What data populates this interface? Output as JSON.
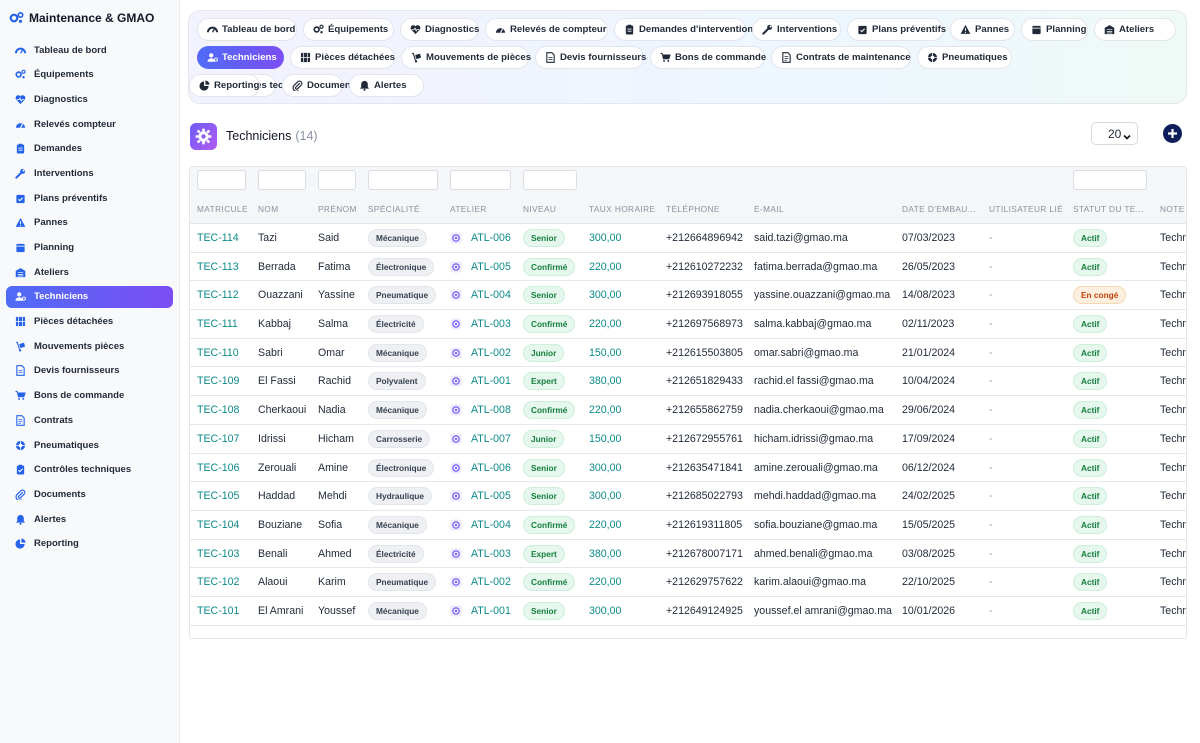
{
  "app": {
    "title": "Maintenance & GMAO"
  },
  "sidebar": {
    "items": [
      {
        "label": "Tableau de bord",
        "icon": "dashboard-icon"
      },
      {
        "label": "Équipements",
        "icon": "gears-icon"
      },
      {
        "label": "Diagnostics",
        "icon": "heart-pulse-icon"
      },
      {
        "label": "Relevés compteur",
        "icon": "gauge-icon"
      },
      {
        "label": "Demandes",
        "icon": "clipboard-icon"
      },
      {
        "label": "Interventions",
        "icon": "wrench-icon"
      },
      {
        "label": "Plans préventifs",
        "icon": "calendar-check-icon"
      },
      {
        "label": "Pannes",
        "icon": "warning-icon"
      },
      {
        "label": "Planning",
        "icon": "calendar-icon"
      },
      {
        "label": "Ateliers",
        "icon": "warehouse-icon"
      },
      {
        "label": "Techniciens",
        "icon": "user-gear-icon",
        "active": true
      },
      {
        "label": "Pièces détachées",
        "icon": "boxes-icon"
      },
      {
        "label": "Mouvements pièces",
        "icon": "dolly-icon"
      },
      {
        "label": "Devis fournisseurs",
        "icon": "file-invoice-icon"
      },
      {
        "label": "Bons de commande",
        "icon": "cart-icon"
      },
      {
        "label": "Contrats",
        "icon": "file-contract-icon"
      },
      {
        "label": "Pneumatiques",
        "icon": "tire-icon"
      },
      {
        "label": "Contrôles techniques",
        "icon": "clipboard-check-icon"
      },
      {
        "label": "Documents",
        "icon": "paperclip-icon"
      },
      {
        "label": "Alertes",
        "icon": "bell-icon"
      },
      {
        "label": "Reporting",
        "icon": "chart-pie-icon"
      }
    ]
  },
  "tabs": [
    {
      "label": "Tableau de bord",
      "icon": "dashboard-icon"
    },
    {
      "label": "Équipements",
      "icon": "gears-icon"
    },
    {
      "label": "Diagnostics",
      "icon": "heart-pulse-icon"
    },
    {
      "label": "Relevés de compteur",
      "icon": "gauge-icon"
    },
    {
      "label": "Demandes d'intervention",
      "icon": "clipboard-icon"
    },
    {
      "label": "Interventions",
      "icon": "wrench-icon"
    },
    {
      "label": "Plans préventifs",
      "icon": "calendar-check-icon"
    },
    {
      "label": "Pannes",
      "icon": "warning-icon"
    },
    {
      "label": "Planning",
      "icon": "calendar-icon"
    },
    {
      "label": "Ateliers",
      "icon": "warehouse-icon"
    },
    {
      "label": "Techniciens",
      "icon": "user-gear-icon",
      "active": true
    },
    {
      "label": "Pièces détachées",
      "icon": "boxes-icon"
    },
    {
      "label": "Mouvements de pièces",
      "icon": "dolly-icon"
    },
    {
      "label": "Devis fournisseurs",
      "icon": "file-invoice-icon"
    },
    {
      "label": "Bons de commande",
      "icon": "cart-icon"
    },
    {
      "label": "Contrats de maintenance",
      "icon": "file-contract-icon"
    },
    {
      "label": "Pneumatiques",
      "icon": "tire-icon"
    },
    {
      "label": "Contrôles techniques",
      "icon": "clipboard-check-icon"
    },
    {
      "label": "Documents",
      "icon": "paperclip-icon"
    },
    {
      "label": "Alertes",
      "icon": "bell-icon"
    },
    {
      "label": "Reporting",
      "icon": "chart-pie-icon"
    }
  ],
  "header": {
    "title": "Techniciens",
    "count": "(14)",
    "page_size": "20"
  },
  "columns": [
    "MATRICULE",
    "NOM",
    "PRÉNOM",
    "SPÉCIALITÉ",
    "ATELIER",
    "NIVEAU",
    "TAUX HORAIRE",
    "TÉLÉPHONE",
    "E-MAIL",
    "DATE D'EMBAU...",
    "UTILISATEUR LIÉ",
    "STATUT DU TE...",
    "NOTE"
  ],
  "rows": [
    {
      "matricule": "TEC-114",
      "nom": "Tazi",
      "prenom": "Said",
      "specialite": "Mécanique",
      "atelier": "ATL-006",
      "niveau": "Senior",
      "taux": "300,00",
      "tel": "+212664896942",
      "email": "said.tazi@gmao.ma",
      "date": "07/03/2023",
      "user": "-",
      "statut": "Actif",
      "note": "Technicien"
    },
    {
      "matricule": "TEC-113",
      "nom": "Berrada",
      "prenom": "Fatima",
      "specialite": "Électronique",
      "atelier": "ATL-005",
      "niveau": "Confirmé",
      "taux": "220,00",
      "tel": "+212610272232",
      "email": "fatima.berrada@gmao.ma",
      "date": "26/05/2023",
      "user": "-",
      "statut": "Actif",
      "note": "Technicien"
    },
    {
      "matricule": "TEC-112",
      "nom": "Ouazzani",
      "prenom": "Yassine",
      "specialite": "Pneumatique",
      "atelier": "ATL-004",
      "niveau": "Senior",
      "taux": "300,00",
      "tel": "+212693918055",
      "email": "yassine.ouazzani@gmao.ma",
      "date": "14/08/2023",
      "user": "-",
      "statut": "En congé",
      "note": "Technicien"
    },
    {
      "matricule": "TEC-111",
      "nom": "Kabbaj",
      "prenom": "Salma",
      "specialite": "Électricité",
      "atelier": "ATL-003",
      "niveau": "Confirmé",
      "taux": "220,00",
      "tel": "+212697568973",
      "email": "salma.kabbaj@gmao.ma",
      "date": "02/11/2023",
      "user": "-",
      "statut": "Actif",
      "note": "Technicien"
    },
    {
      "matricule": "TEC-110",
      "nom": "Sabri",
      "prenom": "Omar",
      "specialite": "Mécanique",
      "atelier": "ATL-002",
      "niveau": "Junior",
      "taux": "150,00",
      "tel": "+212615503805",
      "email": "omar.sabri@gmao.ma",
      "date": "21/01/2024",
      "user": "-",
      "statut": "Actif",
      "note": "Technicien"
    },
    {
      "matricule": "TEC-109",
      "nom": "El Fassi",
      "prenom": "Rachid",
      "specialite": "Polyvalent",
      "atelier": "ATL-001",
      "niveau": "Expert",
      "taux": "380,00",
      "tel": "+212651829433",
      "email": "rachid.el fassi@gmao.ma",
      "date": "10/04/2024",
      "user": "-",
      "statut": "Actif",
      "note": "Technicien"
    },
    {
      "matricule": "TEC-108",
      "nom": "Cherkaoui",
      "prenom": "Nadia",
      "specialite": "Mécanique",
      "atelier": "ATL-008",
      "niveau": "Confirmé",
      "taux": "220,00",
      "tel": "+212655862759",
      "email": "nadia.cherkaoui@gmao.ma",
      "date": "29/06/2024",
      "user": "-",
      "statut": "Actif",
      "note": "Technicien"
    },
    {
      "matricule": "TEC-107",
      "nom": "Idrissi",
      "prenom": "Hicham",
      "specialite": "Carrosserie",
      "atelier": "ATL-007",
      "niveau": "Junior",
      "taux": "150,00",
      "tel": "+212672955761",
      "email": "hicham.idrissi@gmao.ma",
      "date": "17/09/2024",
      "user": "-",
      "statut": "Actif",
      "note": "Technicien"
    },
    {
      "matricule": "TEC-106",
      "nom": "Zerouali",
      "prenom": "Amine",
      "specialite": "Électronique",
      "atelier": "ATL-006",
      "niveau": "Senior",
      "taux": "300,00",
      "tel": "+212635471841",
      "email": "amine.zerouali@gmao.ma",
      "date": "06/12/2024",
      "user": "-",
      "statut": "Actif",
      "note": "Technicien"
    },
    {
      "matricule": "TEC-105",
      "nom": "Haddad",
      "prenom": "Mehdi",
      "specialite": "Hydraulique",
      "atelier": "ATL-005",
      "niveau": "Senior",
      "taux": "300,00",
      "tel": "+212685022793",
      "email": "mehdi.haddad@gmao.ma",
      "date": "24/02/2025",
      "user": "-",
      "statut": "Actif",
      "note": "Technicien"
    },
    {
      "matricule": "TEC-104",
      "nom": "Bouziane",
      "prenom": "Sofia",
      "specialite": "Mécanique",
      "atelier": "ATL-004",
      "niveau": "Confirmé",
      "taux": "220,00",
      "tel": "+212619311805",
      "email": "sofia.bouziane@gmao.ma",
      "date": "15/05/2025",
      "user": "-",
      "statut": "Actif",
      "note": "Technicien"
    },
    {
      "matricule": "TEC-103",
      "nom": "Benali",
      "prenom": "Ahmed",
      "specialite": "Électricité",
      "atelier": "ATL-003",
      "niveau": "Expert",
      "taux": "380,00",
      "tel": "+212678007171",
      "email": "ahmed.benali@gmao.ma",
      "date": "03/08/2025",
      "user": "-",
      "statut": "Actif",
      "note": "Technicien"
    },
    {
      "matricule": "TEC-102",
      "nom": "Alaoui",
      "prenom": "Karim",
      "specialite": "Pneumatique",
      "atelier": "ATL-002",
      "niveau": "Confirmé",
      "taux": "220,00",
      "tel": "+212629757622",
      "email": "karim.alaoui@gmao.ma",
      "date": "22/10/2025",
      "user": "-",
      "statut": "Actif",
      "note": "Technicien"
    },
    {
      "matricule": "TEC-101",
      "nom": "El Amrani",
      "prenom": "Youssef",
      "specialite": "Mécanique",
      "atelier": "ATL-001",
      "niveau": "Senior",
      "taux": "300,00",
      "tel": "+212649124925",
      "email": "youssef.el amrani@gmao.ma",
      "date": "10/01/2026",
      "user": "-",
      "statut": "Actif",
      "note": "Technicien"
    }
  ],
  "colors": {
    "accent_start": "#4f6cf7",
    "accent_end": "#7b4df2",
    "link": "#0d8a8a",
    "ok": "#15803d",
    "warn": "#c2410c",
    "brand_icon": "#2563eb"
  }
}
